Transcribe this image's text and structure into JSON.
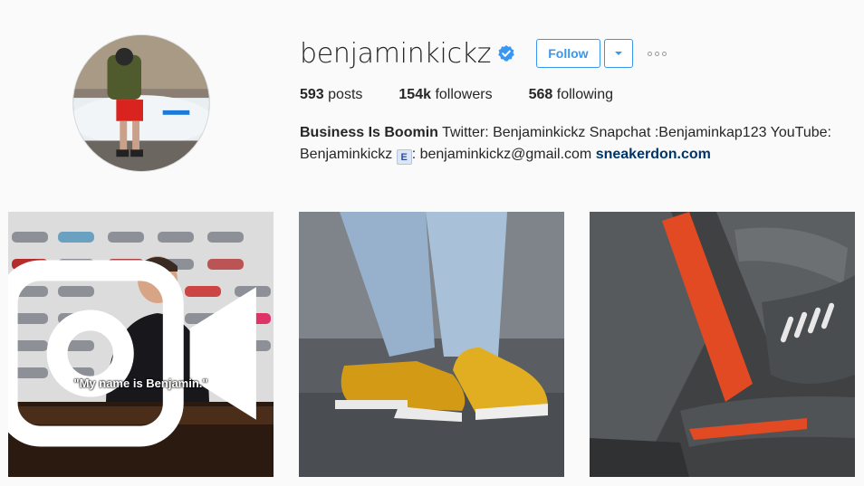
{
  "profile": {
    "username": "benjaminkickz",
    "verified": true,
    "follow_label": "Follow",
    "accent_color": "#3897f0"
  },
  "stats": {
    "posts_count": "593",
    "posts_label": "posts",
    "followers_count": "154k",
    "followers_label": "followers",
    "following_count": "568",
    "following_label": "following"
  },
  "bio": {
    "name": "Business Is Boomin",
    "text": "Twitter: Benjaminkickz Snapchat :Benjaminkap123 YouTube: Benjaminkickz",
    "email_icon": "E",
    "email": ": benjaminkickz@gmail.com",
    "link": "sneakerdon.com"
  },
  "posts": [
    {
      "type": "video",
      "caption": "\"My name is Benjamin.\"",
      "icon": "video-icon"
    },
    {
      "type": "photo",
      "icon": "none"
    },
    {
      "type": "photo",
      "icon": "none"
    }
  ]
}
